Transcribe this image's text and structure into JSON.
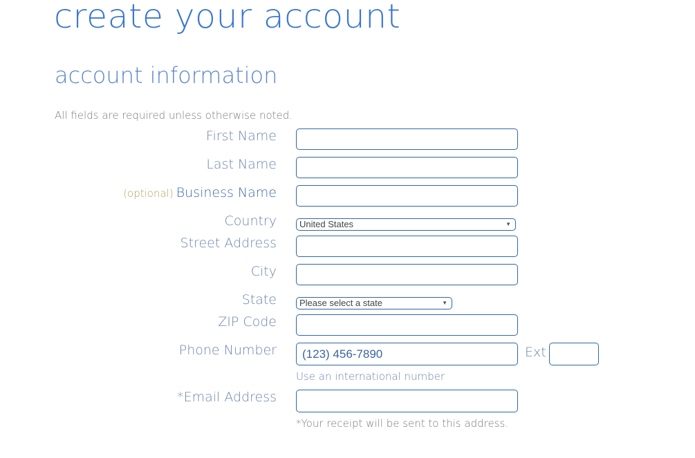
{
  "page": {
    "title": "create your account",
    "section_title": "account information",
    "required_note": "All fields are required unless otherwise noted."
  },
  "form": {
    "first_name": {
      "label": "First Name",
      "value": ""
    },
    "last_name": {
      "label": "Last Name",
      "value": ""
    },
    "business_name": {
      "optional_tag": "(optional)",
      "label": "Business Name",
      "value": ""
    },
    "country": {
      "label": "Country",
      "selected": "United States"
    },
    "street_address": {
      "label": "Street Address",
      "value": ""
    },
    "city": {
      "label": "City",
      "value": ""
    },
    "state": {
      "label": "State",
      "selected": "Please select a state"
    },
    "zip_code": {
      "label": "ZIP Code",
      "value": ""
    },
    "phone_number": {
      "label": "Phone Number",
      "placeholder": "(123) 456-7890",
      "ext_label": "Ext",
      "ext_value": "",
      "international_link": "Use an international number"
    },
    "email": {
      "label": "*Email Address",
      "value": "",
      "note": "*Your receipt will be sent to this address."
    }
  },
  "icons": {
    "dropdown_arrow": "▼"
  },
  "colors": {
    "title": "#3b78d0",
    "label": "#6d85ad",
    "field_border": "#2f67a6",
    "optional": "#b3a45a"
  }
}
